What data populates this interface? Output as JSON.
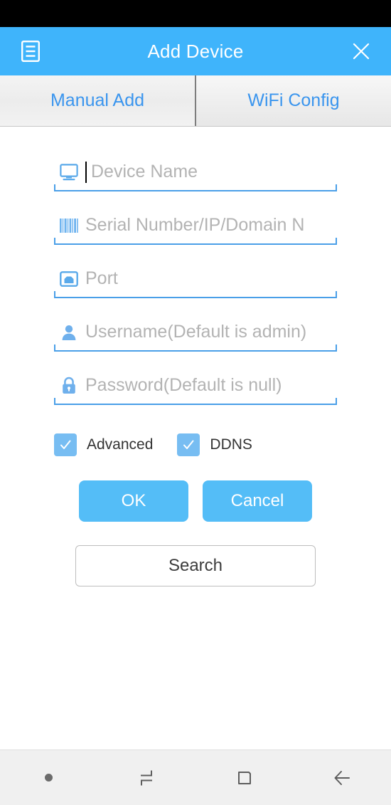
{
  "header": {
    "title": "Add Device",
    "menu_icon": "list-document-icon",
    "close_icon": "close-icon",
    "background_color": "#3fb4fb",
    "title_color": "#ffffff"
  },
  "tabs": [
    {
      "label": "Manual Add",
      "icon": "",
      "active": true
    },
    {
      "label": "WiFi Config",
      "icon": "",
      "active": false
    }
  ],
  "tab_text_color": "#3a95ee",
  "form": {
    "fields": [
      {
        "name": "device-name",
        "icon": "monitor-icon",
        "placeholder": "Device Name",
        "value": "",
        "has_caret": true
      },
      {
        "name": "serial-number",
        "icon": "barcode-icon",
        "placeholder": "Serial Number/IP/Domain N",
        "value": "",
        "has_caret": false
      },
      {
        "name": "port",
        "icon": "ethernet-port-icon",
        "placeholder": "Port",
        "value": "",
        "has_caret": false
      },
      {
        "name": "username",
        "icon": "user-icon",
        "placeholder": "Username(Default is admin)",
        "value": "",
        "has_caret": false
      },
      {
        "name": "password",
        "icon": "lock-icon",
        "placeholder": "Password(Default is null)",
        "value": "",
        "has_caret": false
      }
    ],
    "checkboxes": [
      {
        "label": "Advanced",
        "checked": true
      },
      {
        "label": "DDNS",
        "checked": true
      }
    ],
    "buttons": {
      "ok": "OK",
      "cancel": "Cancel",
      "search": "Search"
    },
    "accent_color": "#54bdf7",
    "underline_color": "#4a9fe8",
    "placeholder_color": "#b3b3b3",
    "checkbox_color": "#77bdf2"
  },
  "nav_bar": {
    "items": [
      {
        "name": "dot-indicator",
        "icon": "dot-icon"
      },
      {
        "name": "recents",
        "icon": "recents-icon"
      },
      {
        "name": "home",
        "icon": "home-square-icon"
      },
      {
        "name": "back",
        "icon": "back-arrow-icon"
      }
    ],
    "background_color": "#f0f0f0",
    "icon_color": "#5e5e5e"
  }
}
